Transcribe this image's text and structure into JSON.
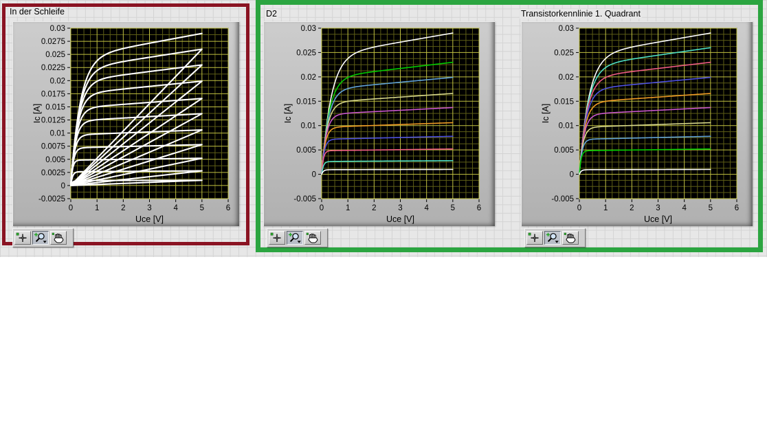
{
  "frames": {
    "loop_border_color": "#8a1322",
    "output_border_color": "#2ba540"
  },
  "background": {
    "front_panel_color": "#e7e7e7",
    "front_panel_gridline_color": "#d4d4d4",
    "page_color": "#ffffff"
  },
  "panels": [
    {
      "title": "In der Schleife"
    },
    {
      "title": "D2"
    },
    {
      "title": "Transistorkennlinie 1. Quadrant"
    }
  ],
  "graph_palette": {
    "buttons": [
      {
        "name": "cursor-tool",
        "icon": "crosshair-icon",
        "selected": false
      },
      {
        "name": "zoom-tool",
        "icon": "magnifier-zoom-icon",
        "selected": true
      },
      {
        "name": "pan-tool",
        "icon": "pan-hand-icon",
        "selected": false
      }
    ]
  },
  "chart_data": [
    {
      "id": "in-der-schleife",
      "type": "line",
      "title": "In der Schleife",
      "xlabel": "Uce [V]",
      "ylabel": "Ic [A]",
      "xlim": [
        0,
        6
      ],
      "ylim": [
        -0.0025,
        0.03
      ],
      "xticks": [
        0,
        1,
        2,
        3,
        4,
        5,
        6
      ],
      "yticks": [
        0.03,
        0.0275,
        0.025,
        0.0225,
        0.02,
        0.0175,
        0.015,
        0.0125,
        0.01,
        0.0075,
        0.005,
        0.0025,
        0,
        -0.0025
      ],
      "x_minor_per_major": 4,
      "y_minor_per_major": 2,
      "plot_bg": "#000000",
      "grid_major_color": "#c2c242",
      "grid_minor_color": "#5e5e16",
      "x_sweep_end": 5,
      "connect_back_to_origin": true,
      "stroke_width": 2.1,
      "legend": "off",
      "series": [
        {
          "color": "#ffffff",
          "Ic_sat": 0.001
        },
        {
          "color": "#ffffff",
          "Ic_sat": 0.0028
        },
        {
          "color": "#ffffff",
          "Ic_sat": 0.0052
        },
        {
          "color": "#ffffff",
          "Ic_sat": 0.0078
        },
        {
          "color": "#ffffff",
          "Ic_sat": 0.0106
        },
        {
          "color": "#ffffff",
          "Ic_sat": 0.0137
        },
        {
          "color": "#ffffff",
          "Ic_sat": 0.0166
        },
        {
          "color": "#ffffff",
          "Ic_sat": 0.0199
        },
        {
          "color": "#ffffff",
          "Ic_sat": 0.023
        },
        {
          "color": "#ffffff",
          "Ic_sat": 0.026
        },
        {
          "color": "#ffffff",
          "Ic_sat": 0.029
        }
      ]
    },
    {
      "id": "d2",
      "type": "line",
      "title": "D2",
      "xlabel": "Uce [V]",
      "ylabel": "Ic [A]",
      "xlim": [
        0,
        6
      ],
      "ylim": [
        -0.005,
        0.03
      ],
      "xticks": [
        0,
        1,
        2,
        3,
        4,
        5,
        6
      ],
      "yticks": [
        0.03,
        0.025,
        0.02,
        0.015,
        0.01,
        0.005,
        0,
        -0.005
      ],
      "x_minor_per_major": 4,
      "y_minor_per_major": 4,
      "plot_bg": "#000000",
      "grid_major_color": "#c2c242",
      "grid_minor_color": "#5e5e16",
      "x_sweep_end": 5,
      "connect_back_to_origin": false,
      "stroke_width": 1.6,
      "legend": "off",
      "series": [
        {
          "color": "#ffffff",
          "Ic_sat": 0.029
        },
        {
          "color": "#00cc00",
          "Ic_sat": 0.023
        },
        {
          "color": "#62a3d8",
          "Ic_sat": 0.0199
        },
        {
          "color": "#d6d68a",
          "Ic_sat": 0.0166
        },
        {
          "color": "#c957cc",
          "Ic_sat": 0.0137
        },
        {
          "color": "#ef9b26",
          "Ic_sat": 0.0106
        },
        {
          "color": "#4f52e2",
          "Ic_sat": 0.0078
        },
        {
          "color": "#ef5d85",
          "Ic_sat": 0.0052
        },
        {
          "color": "#4fe0c4",
          "Ic_sat": 0.0028
        },
        {
          "color": "#ffffff",
          "Ic_sat": 0.001
        }
      ]
    },
    {
      "id": "transistorkennlinie-1-quadrant",
      "type": "line",
      "title": "Transistorkennlinie 1. Quadrant",
      "xlabel": "Uce [V]",
      "ylabel": "Ic [A]",
      "xlim": [
        0,
        6
      ],
      "ylim": [
        -0.005,
        0.03
      ],
      "xticks": [
        0,
        1,
        2,
        3,
        4,
        5,
        6
      ],
      "yticks": [
        0.03,
        0.025,
        0.02,
        0.015,
        0.01,
        0.005,
        0,
        -0.005
      ],
      "x_minor_per_major": 4,
      "y_minor_per_major": 4,
      "plot_bg": "#000000",
      "grid_major_color": "#c2c242",
      "grid_minor_color": "#5e5e16",
      "x_sweep_end": 5,
      "connect_back_to_origin": false,
      "stroke_width": 1.6,
      "legend": "off",
      "series": [
        {
          "color": "#ffffff",
          "Ic_sat": 0.029
        },
        {
          "color": "#4fe0c4",
          "Ic_sat": 0.026
        },
        {
          "color": "#ef5d85",
          "Ic_sat": 0.023
        },
        {
          "color": "#4f52e2",
          "Ic_sat": 0.0199
        },
        {
          "color": "#ef9b26",
          "Ic_sat": 0.0166
        },
        {
          "color": "#c957cc",
          "Ic_sat": 0.0137
        },
        {
          "color": "#d6d68a",
          "Ic_sat": 0.0106
        },
        {
          "color": "#62a3d8",
          "Ic_sat": 0.0078
        },
        {
          "color": "#00cc00",
          "Ic_sat": 0.0052
        },
        {
          "color": "#ffffff",
          "Ic_sat": 0.001
        }
      ]
    }
  ]
}
